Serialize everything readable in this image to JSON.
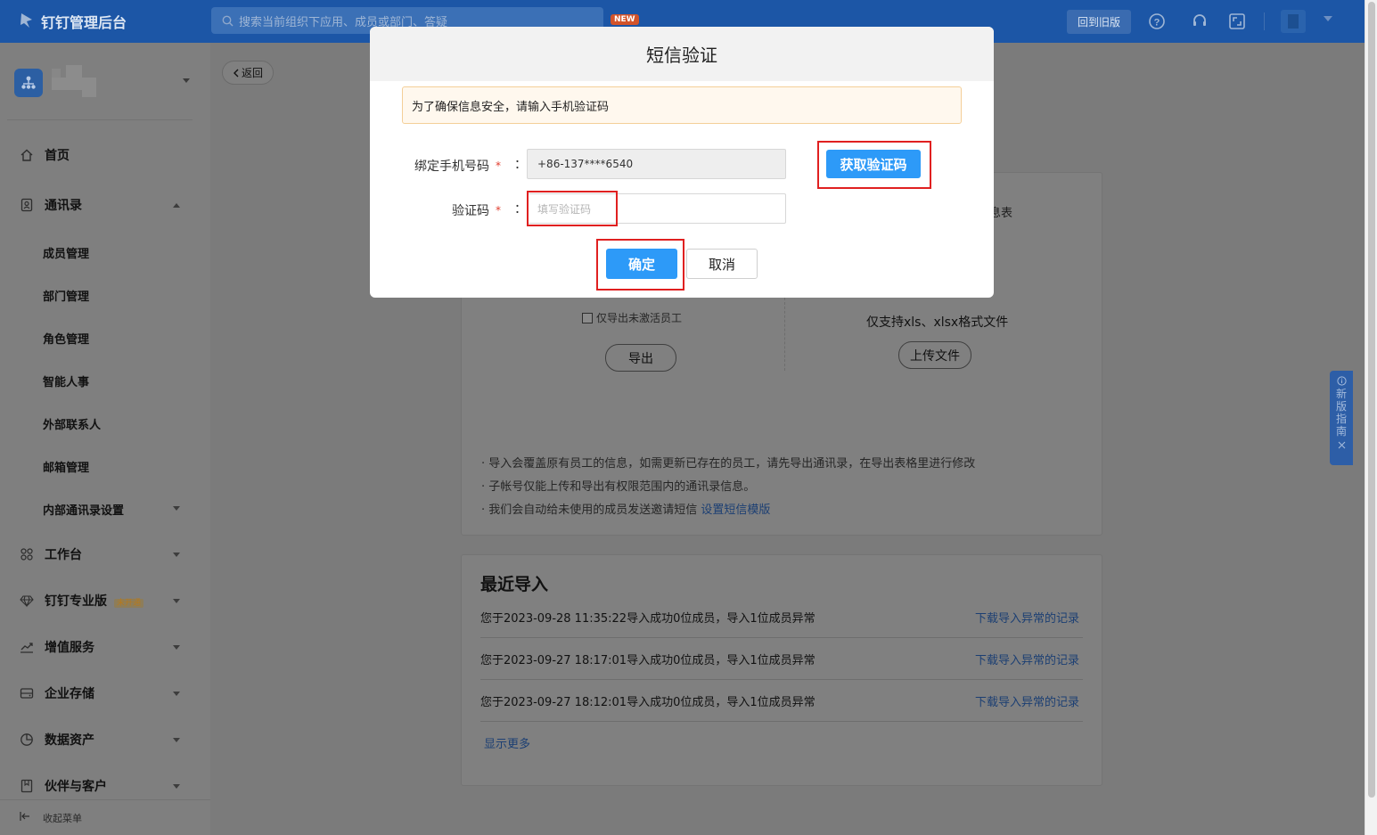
{
  "topbar": {
    "app_title": "钉钉管理后台",
    "search_placeholder": "搜索当前组织下应用、成员或部门、答疑",
    "new_badge": "NEW",
    "old_version_label": "回到旧版"
  },
  "sidebar": {
    "nav": [
      {
        "label": "首页",
        "icon": "home-icon"
      },
      {
        "label": "通讯录",
        "icon": "contacts-icon",
        "expanded": true
      },
      {
        "label": "工作台",
        "icon": "apps-grid-icon"
      },
      {
        "label": "钉钉专业版",
        "icon": "diamond-icon",
        "badge": "未开通"
      },
      {
        "label": "增值服务",
        "icon": "trend-icon"
      },
      {
        "label": "企业存储",
        "icon": "storage-icon"
      },
      {
        "label": "数据资产",
        "icon": "pie-chart-icon"
      },
      {
        "label": "伙伴与客户",
        "icon": "bookmark-icon"
      }
    ],
    "contacts_sub": [
      "成员管理",
      "部门管理",
      "角色管理",
      "智能人事",
      "外部联系人",
      "邮箱管理",
      "内部通讯录设置"
    ],
    "collapse_label": "收起菜单"
  },
  "content": {
    "back_label": "返回",
    "partial_text_right": "息表",
    "export_checkbox_label": "仅导出未激活员工",
    "export_button": "导出",
    "file_format_hint": "仅支持xls、xlsx格式文件",
    "upload_button": "上传文件",
    "tips": [
      "· 导入会覆盖原有员工的信息，如需更新已存在的员工，请先导出通讯录，在导出表格里进行修改",
      "· 子帐号仅能上传和导出有权限范围内的通讯录信息。",
      "· 我们会自动给未使用的成员发送邀请短信"
    ],
    "tips_link": "设置短信模版",
    "recent": {
      "title": "最近导入",
      "rows": [
        {
          "text": "您于2023-09-28 11:35:22导入成功0位成员，导入1位成员异常",
          "link": "下载导入异常的记录"
        },
        {
          "text": "您于2023-09-27 18:17:01导入成功0位成员，导入1位成员异常",
          "link": "下载导入异常的记录"
        },
        {
          "text": "您于2023-09-27 18:12:01导入成功0位成员，导入1位成员异常",
          "link": "下载导入异常的记录"
        }
      ],
      "show_more": "显示更多"
    },
    "guide_chars": [
      "新",
      "版",
      "指",
      "南"
    ]
  },
  "modal": {
    "title": "短信验证",
    "notice": "为了确保信息安全，请输入手机验证码",
    "phone_label": "绑定手机号码",
    "phone_value": "+86-137****6540",
    "code_label": "验证码",
    "code_placeholder": "填写验证码",
    "required_mark": "*",
    "colon": "：",
    "get_code_button": "获取验证码",
    "confirm_button": "确定",
    "cancel_button": "取消"
  },
  "colors": {
    "primary": "#2d9af8",
    "highlight": "#e02020",
    "topbar": "#1c56a6"
  }
}
